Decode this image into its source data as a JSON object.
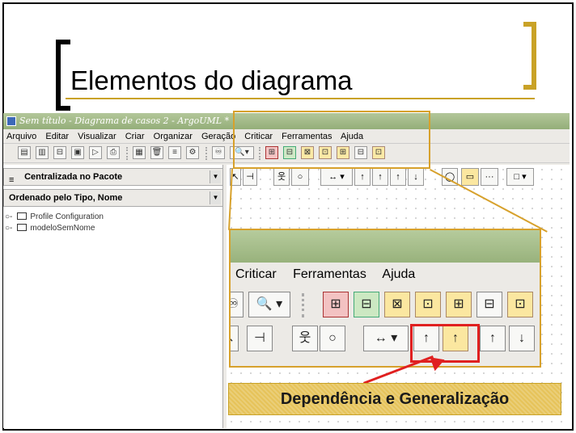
{
  "slide": {
    "title": "Elementos do diagrama"
  },
  "window": {
    "title": "Sem título - Diagrama de casos 2 - ArgoUML *"
  },
  "menubar": [
    "Arquivo",
    "Editar",
    "Visualizar",
    "Criar",
    "Organizar",
    "Geração",
    "Criticar",
    "Ferramentas",
    "Ajuda"
  ],
  "explorer": {
    "perspective": "Centralizada no Pacote",
    "order": "Ordenado pelo Tipo, Nome",
    "tree": [
      "Profile Configuration",
      "modeloSemNome"
    ]
  },
  "zoom": {
    "menu": [
      "Criticar",
      "Ferramentas",
      "Ajuda"
    ]
  },
  "caption": "Dependência e Generalização",
  "colors": {
    "frame": "#d7a12c",
    "highlight": "#e02020",
    "caption_bg": "#e6c35a",
    "titlebar": "#94ae79"
  }
}
